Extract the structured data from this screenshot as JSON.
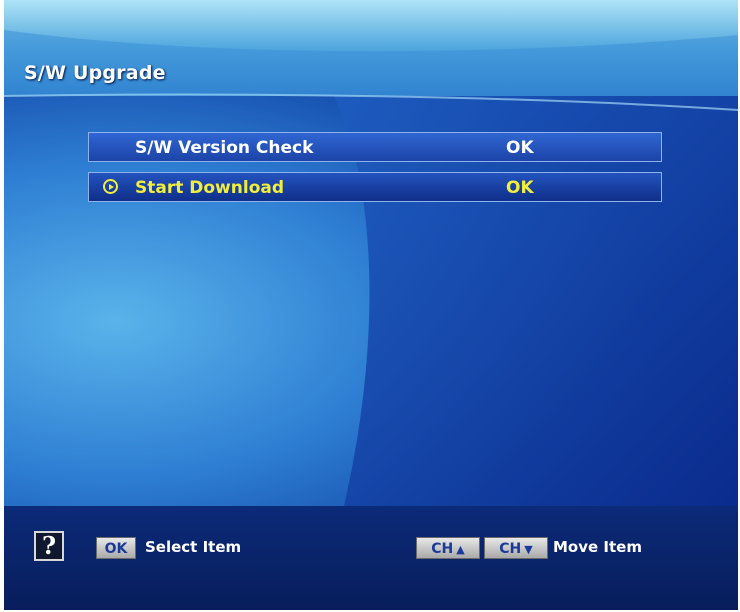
{
  "screen": {
    "title": "S/W Upgrade"
  },
  "menu": {
    "items": [
      {
        "label": "S/W Version Check",
        "value": "OK",
        "selected": false
      },
      {
        "label": "Start Download",
        "value": "OK",
        "selected": true
      }
    ]
  },
  "footer": {
    "help_icon": "question-mark-icon",
    "ok_key": "OK",
    "select_label": "Select Item",
    "ch_up_key": "CH",
    "ch_down_key": "CH",
    "move_label": "Move Item"
  },
  "colors": {
    "background_dark": "#0a2a8c",
    "highlight_text": "#f1ee3c",
    "row_border": "#8fb2ee"
  }
}
